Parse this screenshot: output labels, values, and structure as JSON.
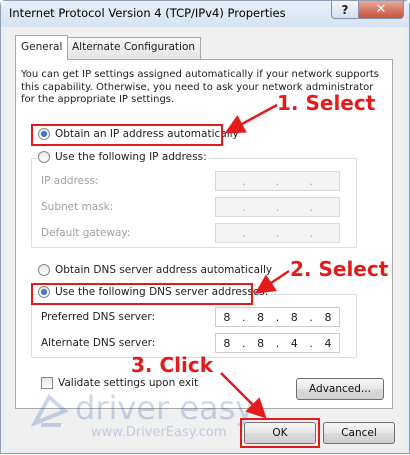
{
  "window": {
    "title": "Internet Protocol Version 4 (TCP/IPv4) Properties",
    "help_glyph": "?",
    "close_glyph": "✕"
  },
  "tabs": [
    {
      "label": "General",
      "active": true
    },
    {
      "label": "Alternate Configuration",
      "active": false
    }
  ],
  "intro_text": "You can get IP settings assigned automatically if your network supports this capability. Otherwise, you need to ask your network administrator for the appropriate IP settings.",
  "ip_section": {
    "auto_label": "Obtain an IP address automatically",
    "auto_selected": true,
    "manual_label": "Use the following IP address:",
    "manual_selected": false,
    "fields": [
      {
        "label": "IP address:",
        "value": [
          "",
          "",
          "",
          ""
        ]
      },
      {
        "label": "Subnet mask:",
        "value": [
          "",
          "",
          "",
          ""
        ]
      },
      {
        "label": "Default gateway:",
        "value": [
          "",
          "",
          "",
          ""
        ]
      }
    ]
  },
  "dns_section": {
    "auto_label": "Obtain DNS server address automatically",
    "auto_selected": false,
    "manual_label": "Use the following DNS server addresses:",
    "manual_selected": true,
    "preferred": {
      "label": "Preferred DNS server:",
      "octets": [
        "8",
        "8",
        "8",
        "8"
      ]
    },
    "alternate": {
      "label": "Alternate DNS server:",
      "octets": [
        "8",
        "8",
        "4",
        "4"
      ]
    }
  },
  "validate_label": "Validate settings upon exit",
  "validate_checked": false,
  "buttons": {
    "advanced": "Advanced...",
    "ok": "OK",
    "cancel": "Cancel"
  },
  "annotations": {
    "step1": "1. Select",
    "step2": "2. Select",
    "step3": "3. Click",
    "color": "#e51b1b"
  },
  "watermark": {
    "title": "driver easy",
    "url": "www.DriverEasy.com"
  }
}
